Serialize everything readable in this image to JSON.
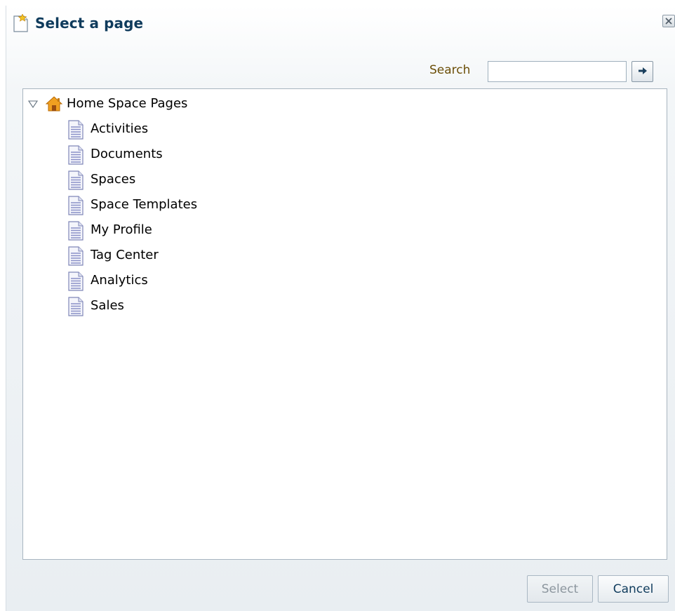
{
  "dialog": {
    "title": "Select a page",
    "icons": {
      "title": "new-page-icon",
      "close": "close-icon"
    }
  },
  "search": {
    "label": "Search",
    "value": "",
    "placeholder": "",
    "go_icon": "arrow-right-icon"
  },
  "tree": {
    "root": {
      "label": "Home Space Pages",
      "expanded": true,
      "icon": "home-icon",
      "toggle_icon": "expand-triangle-icon"
    },
    "items": [
      {
        "label": "Activities",
        "icon": "document-icon"
      },
      {
        "label": "Documents",
        "icon": "document-icon"
      },
      {
        "label": "Spaces",
        "icon": "document-icon"
      },
      {
        "label": "Space Templates",
        "icon": "document-icon"
      },
      {
        "label": "My Profile",
        "icon": "document-icon"
      },
      {
        "label": "Tag Center",
        "icon": "document-icon"
      },
      {
        "label": "Analytics",
        "icon": "document-icon"
      },
      {
        "label": "Sales",
        "icon": "document-icon"
      }
    ]
  },
  "footer": {
    "select_label": "Select",
    "select_enabled": false,
    "cancel_label": "Cancel"
  },
  "colors": {
    "title": "#0f3b5c",
    "search_label": "#6b4e07",
    "home_icon": "#f0a020",
    "document_icon": "#8a90c8"
  }
}
